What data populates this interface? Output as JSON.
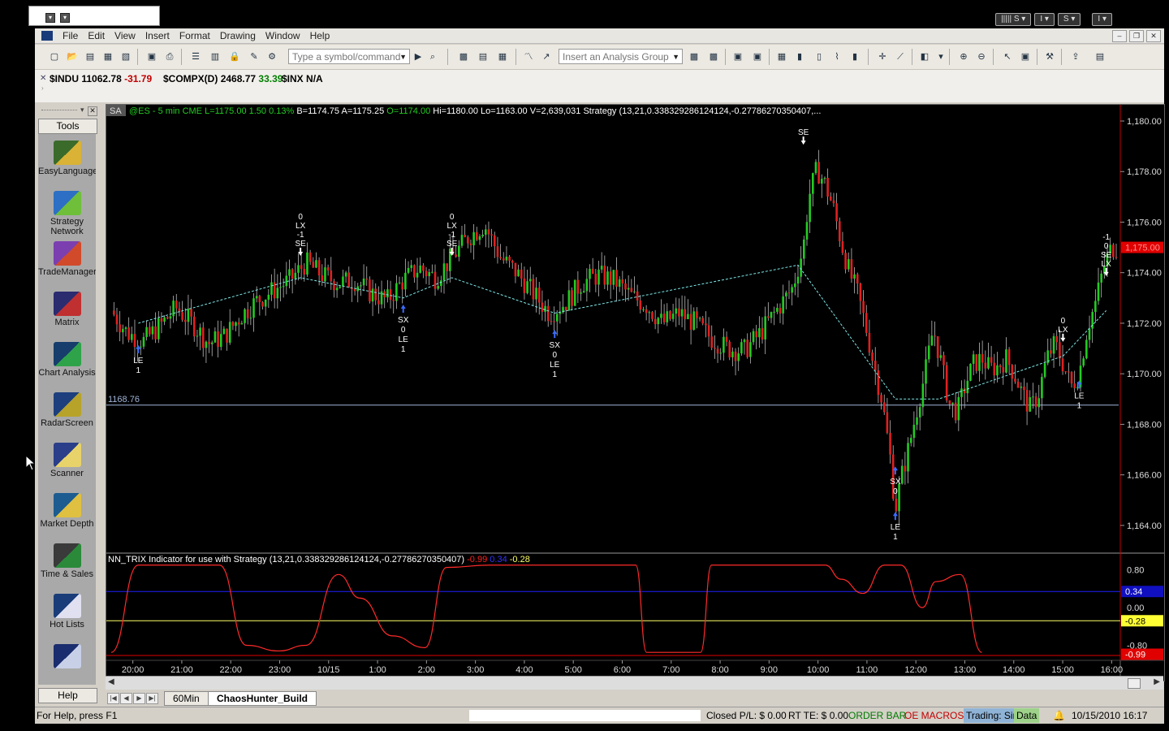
{
  "menu": [
    "File",
    "Edit",
    "View",
    "Insert",
    "Format",
    "Drawing",
    "Window",
    "Help"
  ],
  "window_controls": [
    "S",
    "I",
    "S",
    "I"
  ],
  "toolbar": {
    "symbol_placeholder": "Type a symbol/command",
    "analysis_placeholder": "Insert an Analysis Group"
  },
  "tickers": [
    {
      "symbol": "$INDU",
      "last": "11062.78",
      "change": "-31.79",
      "change_color": "#c00000"
    },
    {
      "symbol": "$COMPX(D)",
      "last": "2468.77",
      "change": "33.39",
      "change_color": "#008000"
    },
    {
      "symbol": "$INX",
      "last": "N/A",
      "change": "",
      "change_color": "#000"
    }
  ],
  "tools": {
    "header": "Tools",
    "help": "Help",
    "items": [
      {
        "label": "EasyLanguage",
        "icon": "easylanguage-icon"
      },
      {
        "label": "Strategy Network",
        "icon": "strategy-network-icon"
      },
      {
        "label": "TradeManager",
        "icon": "trademanager-icon"
      },
      {
        "label": "Matrix",
        "icon": "matrix-icon"
      },
      {
        "label": "Chart Analysis",
        "icon": "chart-analysis-icon"
      },
      {
        "label": "RadarScreen",
        "icon": "radarscreen-icon"
      },
      {
        "label": "Scanner",
        "icon": "scanner-icon"
      },
      {
        "label": "Market Depth",
        "icon": "market-depth-icon"
      },
      {
        "label": "Time & Sales",
        "icon": "time-and-sales-icon"
      },
      {
        "label": "Hot Lists",
        "icon": "hot-lists-icon"
      },
      {
        "label": "",
        "icon": "more-tools-icon"
      }
    ]
  },
  "chart": {
    "tag": "SA",
    "header_green": "@ES - 5 min  CME  L=1175.00  1.50     0.13%",
    "header_white": "B=1174.75  A=1175.25",
    "header_green2": "O=1174.00",
    "header_white2": "Hi=1180.00  Lo=1163.00  V=2,639,031  Strategy (13,21,0.338329286124124,-0.27786270350407,...",
    "price_line_label": "1168.76",
    "last_price_label": "1,175.00",
    "indicator_title": "NN_TRIX Indicator for use with Strategy (13,21,0.338329286124124,-0.27786270350407)",
    "indicator_values": [
      {
        "v": "-0.99",
        "c": "#ff2020"
      },
      {
        "v": "0.34",
        "c": "#3333ff"
      },
      {
        "v": "-0.28",
        "c": "#ffff66"
      }
    ],
    "indicator_axis": [
      "0.80",
      "0.00",
      "-0.80"
    ],
    "indicator_labels": [
      {
        "v": "0.34",
        "bg": "#1010c0",
        "c": "#fff"
      },
      {
        "v": "-0.28",
        "bg": "#ffff33",
        "c": "#000"
      },
      {
        "v": "-0.99",
        "bg": "#e00000",
        "c": "#fff"
      }
    ]
  },
  "chart_data": {
    "type": "line",
    "title": "@ES - 5 min",
    "x_ticks": [
      "20:00",
      "21:00",
      "22:00",
      "23:00",
      "10/15",
      "1:00",
      "2:00",
      "3:00",
      "4:00",
      "5:00",
      "6:00",
      "7:00",
      "8:00",
      "9:00",
      "10:00",
      "11:00",
      "12:00",
      "13:00",
      "14:00",
      "15:00",
      "16:00"
    ],
    "y_ticks": [
      "1,180.00",
      "1,178.00",
      "1,176.00",
      "1,174.00",
      "1,172.00",
      "1,170.00",
      "1,168.00",
      "1,166.00",
      "1,164.00"
    ],
    "ylim": [
      1163,
      1180
    ],
    "price_line": 1168.76,
    "last_price": 1175.0,
    "close_path": [
      [
        0,
        1172.5
      ],
      [
        6,
        1171.6
      ],
      [
        12,
        1171.3
      ],
      [
        18,
        1171.9
      ],
      [
        24,
        1172.6
      ],
      [
        30,
        1172.0
      ],
      [
        36,
        1171.2
      ],
      [
        42,
        1171.5
      ],
      [
        48,
        1172.3
      ],
      [
        54,
        1172.9
      ],
      [
        60,
        1173.3
      ],
      [
        66,
        1173.7
      ],
      [
        72,
        1174.4
      ],
      [
        78,
        1173.9
      ],
      [
        84,
        1173.6
      ],
      [
        90,
        1173.7
      ],
      [
        96,
        1173.2
      ],
      [
        102,
        1172.9
      ],
      [
        108,
        1173.7
      ],
      [
        114,
        1174.2
      ],
      [
        120,
        1173.8
      ],
      [
        126,
        1174.6
      ],
      [
        132,
        1175.4
      ],
      [
        138,
        1175.9
      ],
      [
        144,
        1174.6
      ],
      [
        150,
        1174.0
      ],
      [
        156,
        1173.2
      ],
      [
        162,
        1172.4
      ],
      [
        168,
        1172.8
      ],
      [
        174,
        1173.6
      ],
      [
        180,
        1173.9
      ],
      [
        186,
        1173.7
      ],
      [
        192,
        1173.1
      ],
      [
        198,
        1172.7
      ],
      [
        204,
        1172.0
      ],
      [
        210,
        1172.4
      ],
      [
        216,
        1172.0
      ],
      [
        222,
        1171.4
      ],
      [
        228,
        1171.0
      ],
      [
        234,
        1170.9
      ],
      [
        240,
        1171.6
      ],
      [
        246,
        1172.5
      ],
      [
        252,
        1173.4
      ],
      [
        256,
        1175.0
      ],
      [
        258,
        1177.0
      ],
      [
        261,
        1178.1
      ],
      [
        264,
        1177.5
      ],
      [
        267,
        1176.6
      ],
      [
        270,
        1175.2
      ],
      [
        273,
        1174.0
      ],
      [
        276,
        1173.2
      ],
      [
        279,
        1171.9
      ],
      [
        282,
        1170.4
      ],
      [
        285,
        1169.0
      ],
      [
        288,
        1166.8
      ],
      [
        290,
        1164.6
      ],
      [
        292,
        1165.8
      ],
      [
        295,
        1167.1
      ],
      [
        298,
        1168.6
      ],
      [
        301,
        1170.0
      ],
      [
        304,
        1171.8
      ],
      [
        307,
        1170.4
      ],
      [
        310,
        1168.8
      ],
      [
        313,
        1168.5
      ],
      [
        316,
        1169.6
      ],
      [
        319,
        1170.4
      ],
      [
        322,
        1170.6
      ],
      [
        325,
        1170.2
      ],
      [
        328,
        1170.3
      ],
      [
        331,
        1170.6
      ],
      [
        334,
        1170.0
      ],
      [
        337,
        1169.2
      ],
      [
        340,
        1168.6
      ],
      [
        343,
        1169.2
      ],
      [
        346,
        1170.6
      ],
      [
        349,
        1171.2
      ],
      [
        352,
        1170.4
      ],
      [
        355,
        1169.5
      ],
      [
        358,
        1170.0
      ],
      [
        361,
        1171.8
      ],
      [
        364,
        1172.8
      ],
      [
        367,
        1174.2
      ],
      [
        370,
        1175.0
      ]
    ],
    "strategy_line": [
      [
        10,
        1172.0
      ],
      [
        70,
        1173.8
      ],
      [
        108,
        1173.0
      ],
      [
        126,
        1173.8
      ],
      [
        164,
        1172.4
      ],
      [
        254,
        1174.3
      ],
      [
        290,
        1169.0
      ],
      [
        306,
        1169.0
      ],
      [
        352,
        1170.7
      ],
      [
        368,
        1172.5
      ]
    ],
    "trade_markers": [
      {
        "t": 10,
        "price": 1171.2,
        "labels": [
          "LE",
          "1"
        ],
        "dir": "up"
      },
      {
        "t": 70,
        "price": 1174.6,
        "labels": [
          "0",
          "LX",
          "-1",
          "SE"
        ],
        "dir": "down"
      },
      {
        "t": 108,
        "price": 1172.8,
        "labels": [
          "SX",
          "0",
          "LE",
          "1"
        ],
        "dir": "up"
      },
      {
        "t": 126,
        "price": 1174.6,
        "labels": [
          "0",
          "LX",
          "-1",
          "SE"
        ],
        "dir": "down"
      },
      {
        "t": 164,
        "price": 1171.8,
        "labels": [
          "SX",
          "0",
          "LE",
          "1"
        ],
        "dir": "up"
      },
      {
        "t": 256,
        "price": 1179.0,
        "labels": [
          "SE"
        ],
        "dir": "down"
      },
      {
        "t": 290,
        "price": 1166.4,
        "labels": [
          "SX",
          "0"
        ],
        "dir": "up"
      },
      {
        "t": 290,
        "price": 1164.6,
        "labels": [
          "LE",
          "1"
        ],
        "dir": "up"
      },
      {
        "t": 352,
        "price": 1171.2,
        "labels": [
          "0",
          "LX"
        ],
        "dir": "down"
      },
      {
        "t": 358,
        "price": 1169.8,
        "labels": [
          "LE",
          "1"
        ],
        "dir": "up"
      },
      {
        "t": 368,
        "price": 1173.8,
        "labels": [
          "-1",
          "0",
          "SE",
          "LX"
        ],
        "dir": "down"
      }
    ],
    "indicator_series": {
      "name": "NN_TRIX",
      "values": [
        [
          0,
          -0.95
        ],
        [
          10,
          0.9
        ],
        [
          40,
          0.9
        ],
        [
          50,
          -0.8
        ],
        [
          62,
          -0.92
        ],
        [
          72,
          -0.8
        ],
        [
          84,
          0.7
        ],
        [
          92,
          0.2
        ],
        [
          104,
          -0.6
        ],
        [
          116,
          -0.85
        ],
        [
          124,
          0.85
        ],
        [
          140,
          0.9
        ],
        [
          194,
          0.9
        ],
        [
          198,
          -0.95
        ],
        [
          218,
          -0.95
        ],
        [
          222,
          0.9
        ],
        [
          264,
          0.9
        ],
        [
          270,
          0.6
        ],
        [
          278,
          0.3
        ],
        [
          286,
          0.9
        ],
        [
          292,
          0.9
        ],
        [
          300,
          0.0
        ],
        [
          305,
          0.55
        ],
        [
          314,
          0.7
        ],
        [
          322,
          -0.95
        ]
      ]
    },
    "indicator_upper": 0.34,
    "indicator_lower": -0.28,
    "indicator_ylim": [
      -1.05,
      1.05
    ]
  },
  "tabs": [
    "60Min",
    "ChaosHunter_Build"
  ],
  "status": {
    "help": "For Help, press F1",
    "closed_pl": "Closed P/L: $ 0.00",
    "rt_te": "RT TE: $ 0.00",
    "order_bar": "ORDER BAR",
    "oe_macros": "OE MACROS",
    "trading": "Trading: Sim",
    "data": "Data",
    "datetime": "10/15/2010 16:17"
  }
}
